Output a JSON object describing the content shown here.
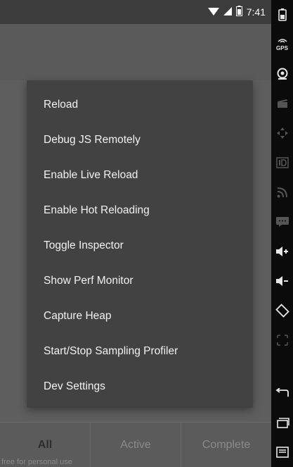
{
  "status_bar": {
    "time": "7:41",
    "icons": [
      "wifi-icon",
      "signal-icon",
      "battery-icon"
    ]
  },
  "dev_menu": {
    "items": [
      {
        "label": "Reload"
      },
      {
        "label": "Debug JS Remotely"
      },
      {
        "label": "Enable Live Reload"
      },
      {
        "label": "Enable Hot Reloading"
      },
      {
        "label": "Toggle Inspector"
      },
      {
        "label": "Show Perf Monitor"
      },
      {
        "label": "Capture Heap"
      },
      {
        "label": "Start/Stop Sampling Profiler"
      },
      {
        "label": "Dev Settings"
      }
    ]
  },
  "tab_bar": {
    "tabs": [
      {
        "label": "All",
        "selected": true
      },
      {
        "label": "Active",
        "selected": false
      },
      {
        "label": "Complete",
        "selected": false
      }
    ]
  },
  "watermark": "free for personal use",
  "emulator_panel": {
    "gps_label": "GPS",
    "buttons": [
      "power-icon",
      "gps-icon",
      "camera-icon",
      "clapper-icon",
      "dpad-icon",
      "id-icon",
      "rss-icon",
      "sms-icon",
      "volume-up-icon",
      "volume-down-icon",
      "rotate-icon",
      "scale-icon",
      "back-icon",
      "recents-icon",
      "menu-icon"
    ]
  },
  "colors": {
    "dim_overlay": "#5e5e5e",
    "menu_background": "#424242",
    "menu_text": "#f2f2f2",
    "status_bar": "#3c3c3c",
    "emulator_panel": "#0b0b0b"
  }
}
